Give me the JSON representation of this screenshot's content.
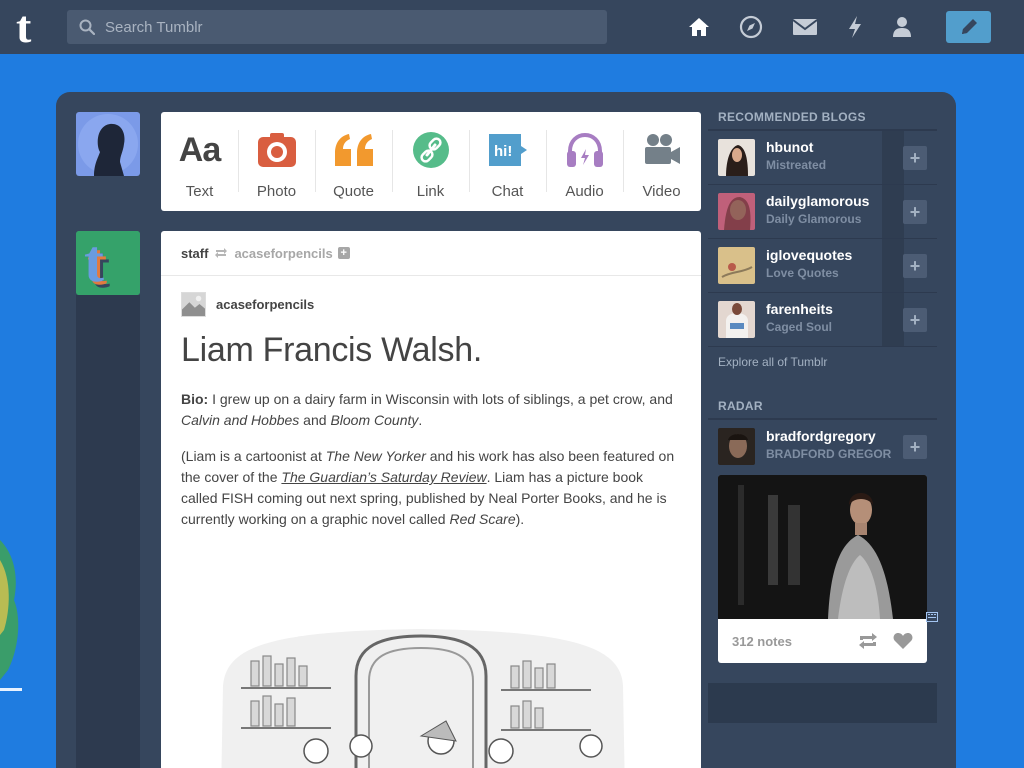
{
  "header": {
    "logo": "t",
    "search_placeholder": "Search Tumblr",
    "nav_icons": [
      "home-icon",
      "explore-icon",
      "inbox-icon",
      "activity-icon",
      "account-icon"
    ],
    "compose_icon": "pencil-icon"
  },
  "post_types": [
    {
      "label": "Text",
      "icon": "text-icon",
      "color": "#444444"
    },
    {
      "label": "Photo",
      "icon": "camera-icon",
      "color": "#d95e40"
    },
    {
      "label": "Quote",
      "icon": "quote-icon",
      "color": "#f2992e"
    },
    {
      "label": "Link",
      "icon": "link-icon",
      "color": "#56bc8a"
    },
    {
      "label": "Chat",
      "icon": "chat-icon",
      "color": "#529ecc"
    },
    {
      "label": "Audio",
      "icon": "headphones-icon",
      "color": "#a77dc2"
    },
    {
      "label": "Video",
      "icon": "video-camera-icon",
      "color": "#748089"
    }
  ],
  "post": {
    "reblogger": "staff",
    "reblogged_from": "acaseforpencils",
    "source_blog": "acaseforpencils",
    "title": "Liam Francis Walsh.",
    "bio_label": "Bio:",
    "bio_text_1": " I grew up on a dairy farm in Wisconsin with lots of siblings, a pet crow, and ",
    "bio_italic_1": "Calvin and Hobbes",
    "bio_text_2": " and ",
    "bio_italic_2": "Bloom County",
    "bio_text_3": ".",
    "p2_text_1": "(Liam is a cartoonist at ",
    "p2_italic_1": "The New Yorker",
    "p2_text_2": " and his work has also been featured on the cover of the ",
    "p2_link": "The Guardian’s Saturday Review",
    "p2_text_3": ". Liam has a picture book called FISH coming out next spring, published by Neal Porter Books, and he is currently working on a graphic novel called ",
    "p2_italic_2": "Red Scare",
    "p2_text_4": ")."
  },
  "sidebar": {
    "recommended_title": "RECOMMENDED BLOGS",
    "blogs": [
      {
        "name": "hbunot",
        "subtitle": "Mistreated",
        "avatar_color": "#6b4a3e"
      },
      {
        "name": "dailyglamorous",
        "subtitle": "Daily Glamorous",
        "avatar_color": "#c0607a"
      },
      {
        "name": "iglovequotes",
        "subtitle": "Love Quotes",
        "avatar_color": "#d9c08a"
      },
      {
        "name": "farenheits",
        "subtitle": "Caged Soul",
        "avatar_color": "#c7b7b0"
      }
    ],
    "follow_symbol": "+",
    "explore_link": "Explore all of Tumblr",
    "radar_title": "RADAR",
    "radar_blog": {
      "name": "bradfordgregory",
      "subtitle": "BRADFORD GREGOR"
    },
    "radar_notes": "312 notes"
  }
}
